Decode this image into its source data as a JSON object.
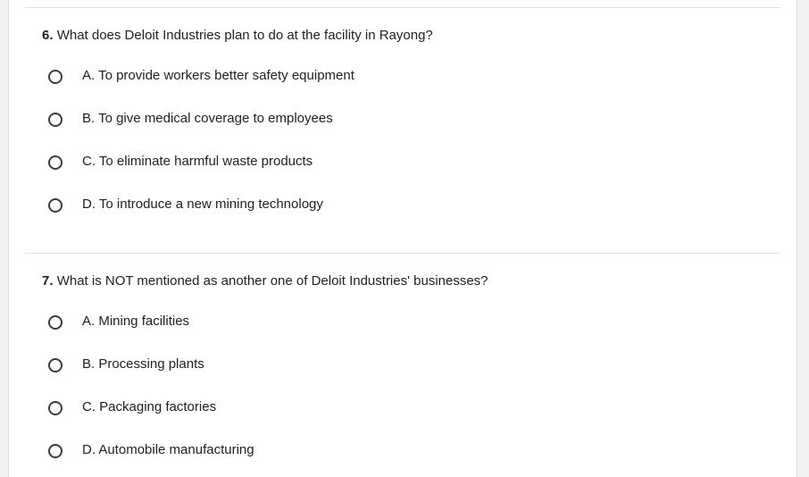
{
  "questions": [
    {
      "number": "6.",
      "text": "What does Deloit Industries plan to do at the facility in Rayong?",
      "options": [
        "A. To provide workers better safety equipment",
        "B. To give medical coverage to employees",
        "C. To eliminate harmful waste products",
        "D. To introduce a new mining technology"
      ]
    },
    {
      "number": "7.",
      "text": "What is NOT mentioned as another one of Deloit Industries' businesses?",
      "options": [
        "A. Mining facilities",
        "B. Processing plants",
        "C. Packaging factories",
        "D. Automobile manufacturing"
      ]
    }
  ]
}
